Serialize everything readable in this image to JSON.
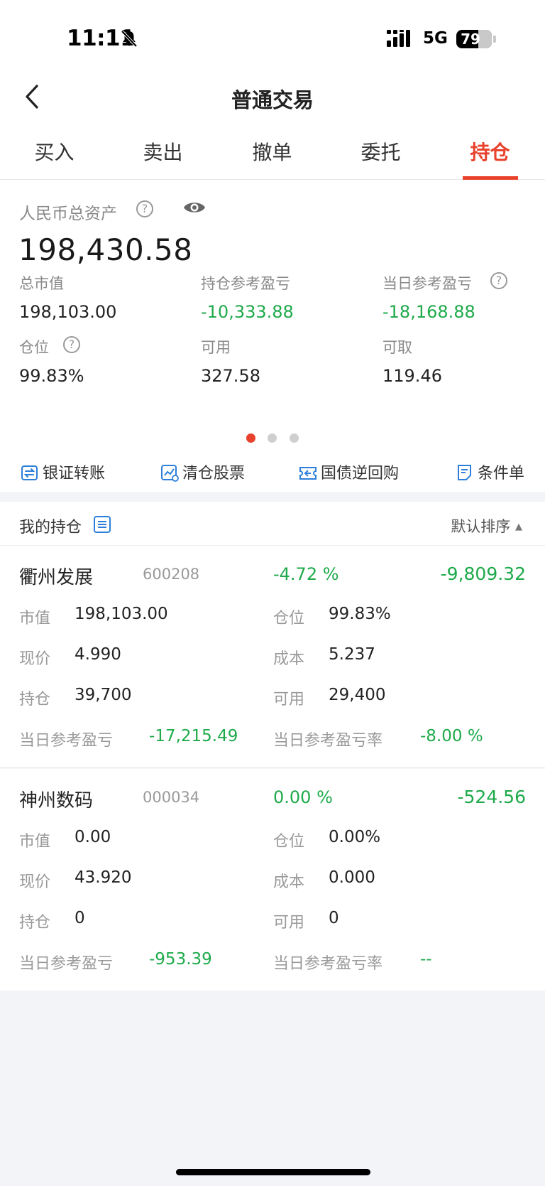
{
  "status_bar": {
    "time": "11:11",
    "network": "5G",
    "battery": "79"
  },
  "nav": {
    "title": "普通交易"
  },
  "tabs": [
    {
      "label": "买入"
    },
    {
      "label": "卖出"
    },
    {
      "label": "撤单"
    },
    {
      "label": "委托"
    },
    {
      "label": "持仓",
      "active": true
    }
  ],
  "assets": {
    "label": "人民币总资产",
    "total": "198,430.58",
    "market_value_label": "总市值",
    "market_value": "198,103.00",
    "position_pl_label": "持仓参考盈亏",
    "position_pl": "-10,333.88",
    "daily_pl_label": "当日参考盈亏",
    "daily_pl": "-18,168.88",
    "position_ratio_label": "仓位",
    "position_ratio": "99.83%",
    "available_label": "可用",
    "available": "327.58",
    "withdrawable_label": "可取",
    "withdrawable": "119.46"
  },
  "actions": [
    {
      "label": "银证转账",
      "icon": "transfer-icon"
    },
    {
      "label": "清仓股票",
      "icon": "chart-clear-icon"
    },
    {
      "label": "国债逆回购",
      "icon": "ticket-icon"
    },
    {
      "label": "条件单",
      "icon": "document-icon"
    }
  ],
  "holdings_header": {
    "title": "我的持仓",
    "sort": "默认排序"
  },
  "holdings": [
    {
      "name": "衢州发展",
      "code": "600208",
      "pct": "-4.72 %",
      "pl": "-9,809.32",
      "market_value": "198,103.00",
      "position": "99.83%",
      "price": "4.990",
      "cost": "5.237",
      "hold": "39,700",
      "available": "29,400",
      "daily_pl": "-17,215.49",
      "daily_pl_rate": "-8.00 %"
    },
    {
      "name": "神州数码",
      "code": "000034",
      "pct": "0.00 %",
      "pl": "-524.56",
      "market_value": "0.00",
      "position": "0.00%",
      "price": "43.920",
      "cost": "0.000",
      "hold": "0",
      "available": "0",
      "daily_pl": "-953.39",
      "daily_pl_rate": "--"
    }
  ],
  "row_labels": {
    "market_value": "市值",
    "position": "仓位",
    "price": "现价",
    "cost": "成本",
    "hold": "持仓",
    "available": "可用",
    "daily_pl": "当日参考盈亏",
    "daily_pl_rate": "当日参考盈亏率"
  },
  "colors": {
    "accent": "#e8412c",
    "loss_green": "#1eaa4a",
    "icon_blue": "#2e7fd9"
  }
}
